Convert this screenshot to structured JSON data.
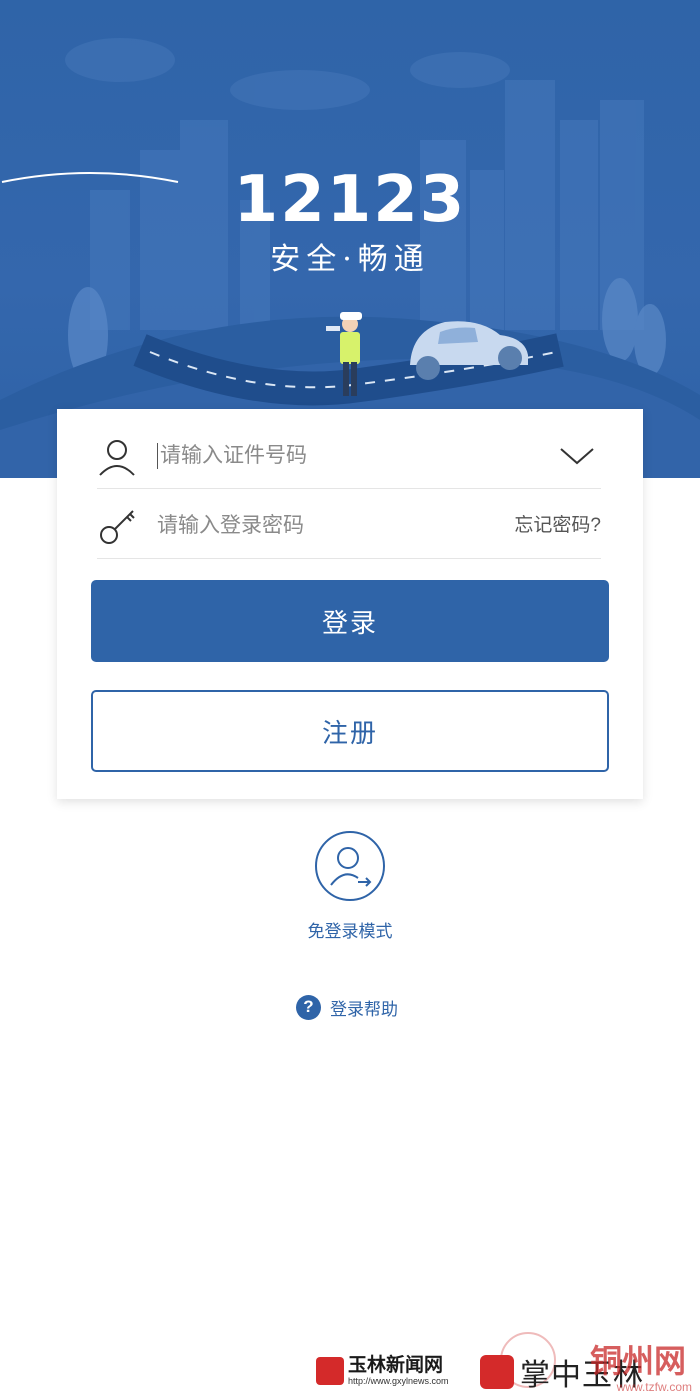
{
  "brand": {
    "number": "12123",
    "slogan": "安全·畅通"
  },
  "login_form": {
    "id_placeholder": "请输入证件号码",
    "password_placeholder": "请输入登录密码",
    "forgot_password": "忘记密码?",
    "login_button": "登录",
    "register_button": "注册"
  },
  "guest_mode": {
    "label": "免登录模式"
  },
  "help": {
    "icon_glyph": "?",
    "label": "登录帮助"
  },
  "watermarks": {
    "left_title": "玉林新闻网",
    "left_url": "http://www.gxylnews.com",
    "right_title": "掌中玉林",
    "right_overlay": "铜州网",
    "right_url": "www.tzfw.com"
  },
  "colors": {
    "primary": "#2f64a8",
    "hero_bg": "#3467ad",
    "card_bg": "#ffffff",
    "placeholder": "#8a8a8a"
  }
}
